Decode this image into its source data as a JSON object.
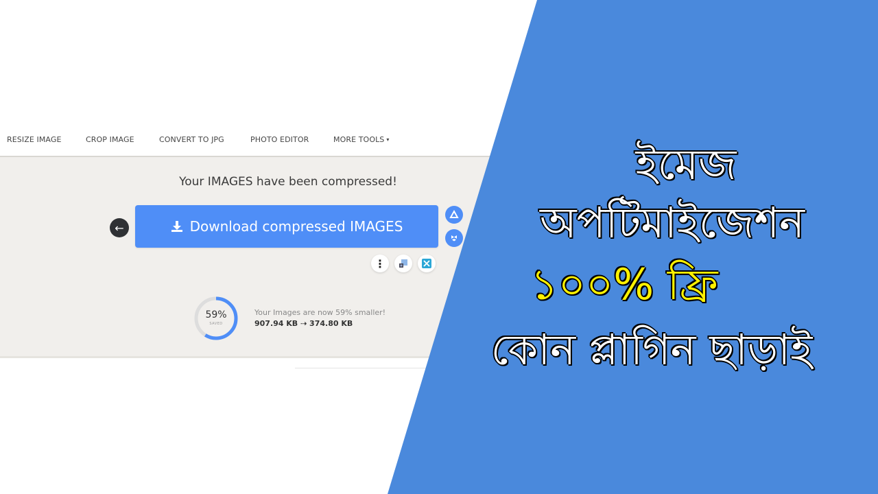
{
  "nav": {
    "items": [
      {
        "label": "RESIZE IMAGE"
      },
      {
        "label": "CROP IMAGE"
      },
      {
        "label": "CONVERT TO JPG"
      },
      {
        "label": "PHOTO EDITOR"
      },
      {
        "label": "MORE TOOLS",
        "has_dropdown": true
      }
    ],
    "caret": "▾"
  },
  "result": {
    "headline": "Your IMAGES have been compressed!",
    "download_label": "Download compressed IMAGES",
    "back_icon": "←",
    "cloud_buttons": [
      "google-drive",
      "dropbox"
    ],
    "action_buttons": [
      "more-options",
      "qr-share",
      "fullscreen"
    ],
    "more_icon": "⋮"
  },
  "stats": {
    "percent_saved": 59,
    "percent_label": "59%",
    "saved_sub": "SAVED",
    "message": "Your Images are now 59% smaller!",
    "sizes": "907.94 KB ⇢ 374.80 KB"
  },
  "banner": {
    "lines": [
      {
        "text": "ইমেজ",
        "color": "#ffffff"
      },
      {
        "text": "অপটিমাইজেশন",
        "color": "#ffffff"
      },
      {
        "text": "১০০% ফ্রি",
        "color": "#fff200"
      },
      {
        "text": "কোন প্লাগিন ছাড়াই",
        "color": "#ffffff"
      }
    ],
    "background_color": "#4a89dc"
  },
  "colors": {
    "accent": "#4f8ef7",
    "panel_bg": "#f1efec",
    "progress_track": "#dddddd"
  }
}
